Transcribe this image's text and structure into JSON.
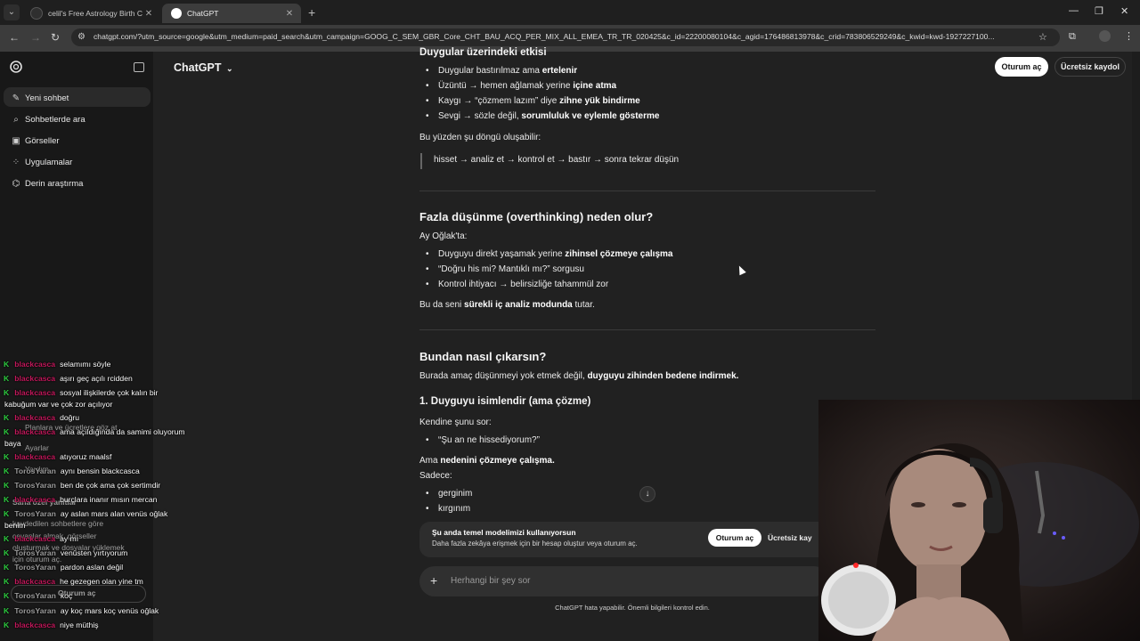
{
  "browser": {
    "tabs": [
      {
        "title": "celil's Free Astrology Birth Cha"
      },
      {
        "title": "ChatGPT"
      }
    ],
    "url": "chatgpt.com/?utm_source=google&utm_medium=paid_search&utm_campaign=GOOG_C_SEM_GBR_Core_CHT_BAU_ACQ_PER_MIX_ALL_EMEA_TR_TR_020425&c_id=22200080104&c_agid=176486813978&c_crid=783806529249&c_kwid=kwd-1927227100..."
  },
  "sidebar": {
    "items": [
      {
        "label": "Yeni sohbet",
        "icon": "edit-icon"
      },
      {
        "label": "Sohbetlerde ara",
        "icon": "search-icon"
      },
      {
        "label": "Görseller",
        "icon": "image-icon"
      },
      {
        "label": "Uygulamalar",
        "icon": "apps-icon"
      },
      {
        "label": "Derin araştırma",
        "icon": "telescope-icon"
      }
    ],
    "bottom": {
      "plans": "Planlara ve ücretlere göz at",
      "settings": "Ayarlar",
      "help": "Yardım",
      "personal": "Sana özel yanıtlar",
      "saved_1": "kaydedilen sohbetlere göre",
      "saved_2": "cevaplar almak, görseller",
      "saved_3": "oluşturmak ve dosyalar yüklemek",
      "saved_4": "için oturum aç.",
      "login": "Oturum aç"
    }
  },
  "header": {
    "model": "ChatGPT",
    "login": "Oturum aç",
    "signup": "Ücretsiz kaydol"
  },
  "conversation": {
    "top_heading": "Duygular üzerindeki etkisi",
    "effects": [
      {
        "text": "Duygular bastırılmaz ama ",
        "bold": "ertelenir"
      },
      {
        "text": "Üzüntü → hemen ağlamak yerine ",
        "bold": "içine atma"
      },
      {
        "text": "Kaygı → “çözmem lazım” diye ",
        "bold": "zihne yük bindirme"
      },
      {
        "text": "Sevgi → sözle değil, ",
        "bold": "sorumluluk ve eylemle gösterme"
      }
    ],
    "cycle_intro": "Bu yüzden şu döngü oluşabilir:",
    "cycle_quote": "hisset → analiz et → kontrol et → bastır → sonra tekrar düşün",
    "overthinking_heading": "Fazla düşünme (overthinking) neden olur?",
    "ay_oglakta": "Ay Oğlak'ta:",
    "reasons": [
      {
        "text": "Duyguyu direkt yaşamak yerine ",
        "bold": "zihinsel çözmeye çalışma"
      },
      {
        "text": "“Doğru his mi? Mantıklı mı?” sorgusu",
        "bold": ""
      },
      {
        "text": "Kontrol ihtiyacı → belirsizliğe tahammül zor",
        "bold": ""
      }
    ],
    "analysis_pre": "Bu da seni ",
    "analysis_bold": "sürekli iç analiz modunda",
    "analysis_post": " tutar.",
    "exit_heading": "Bundan nasıl çıkarsın?",
    "goal_pre": "Burada amaç düşünmeyi yok etmek değil, ",
    "goal_bold": "duyguyu zihinden bedene indirmek.",
    "step1_heading": "1. Duyguyu isimlendir (ama çözme)",
    "ask_yourself": "Kendine şunu sor:",
    "question": "“Şu an ne hissediyorum?”",
    "but_pre": "Ama ",
    "but_bold": "nedenini çözmeye çalışma.",
    "only": "Sadece:",
    "feelings": [
      "gerginim",
      "kırgınım"
    ]
  },
  "banner": {
    "title": "Şu anda temel modelimizi kullanıyorsun",
    "subtitle": "Daha fazla zekâya erişmek için bir hesap oluştur veya oturum aç.",
    "login": "Oturum aç",
    "signup": "Ücretsiz kay"
  },
  "composer": {
    "placeholder": "Herhangi bir şey sor",
    "disclaimer": "ChatGPT hata yapabilir. Önemli bilgileri kontrol edin."
  },
  "stream_chat": [
    {
      "user": "blackcasca",
      "msg": "selamımı söyle"
    },
    {
      "user": "blackcasca",
      "msg": "aşırı geç açılı rcidden"
    },
    {
      "user": "blackcasca",
      "msg": "sosyal ilişkilerde çok kalın bir",
      "cont": "kabuğum var ve çok zor açılıyor"
    },
    {
      "user": "blackcasca",
      "msg": "doğru"
    },
    {
      "user": "blackcasca",
      "msg": "ama açıldığında da samimi oluyorum",
      "cont": "baya"
    },
    {
      "user": "blackcasca",
      "msg": "atıyoruz maalsf"
    },
    {
      "user": "TorosYaran",
      "msg": "aynı bensin blackcasca"
    },
    {
      "user": "TorosYaran",
      "msg": "ben de çok ama çok sertimdir"
    },
    {
      "user": "blackcasca",
      "msg": "burçlara inanır mısın mercan"
    },
    {
      "user": "TorosYaran",
      "msg": "ay aslan mars alan venüs oğlak",
      "cont": "benim"
    },
    {
      "user": "blackcasca",
      "msg": "ay mı"
    },
    {
      "user": "TorosYaran",
      "msg": "venüsten yırtıyorum"
    },
    {
      "user": "TorosYaran",
      "msg": "pardon aslan değil"
    },
    {
      "user": "blackcasca",
      "msg": "he gezegen olan yine tm"
    },
    {
      "user": "TorosYaran",
      "msg": "koç"
    },
    {
      "user": "TorosYaran",
      "msg": "ay koç mars koç venüs oğlak"
    },
    {
      "user": "blackcasca",
      "msg": "niye müthiş"
    }
  ]
}
